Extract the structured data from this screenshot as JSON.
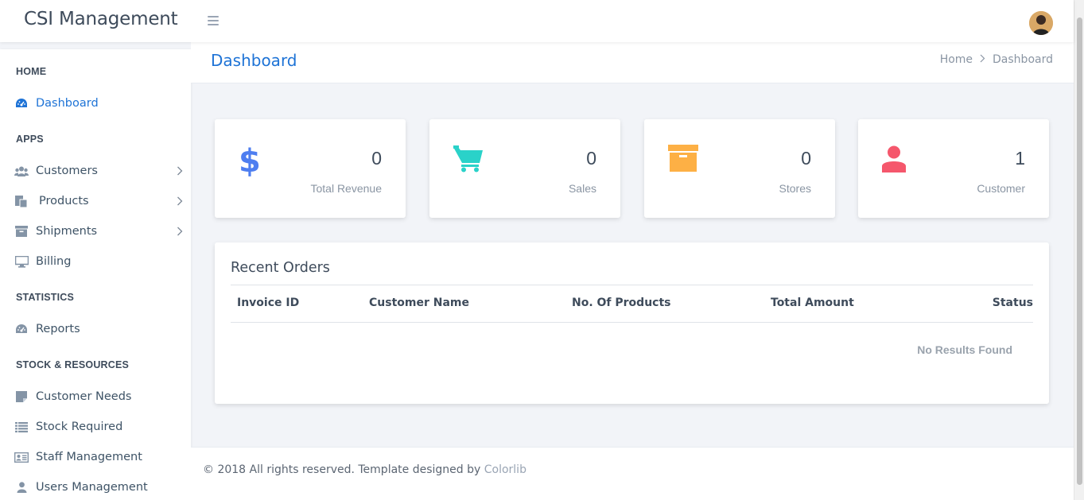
{
  "brand": "CSI Management",
  "header": {
    "menu_icon": "hamburger-icon",
    "avatar": "user-avatar"
  },
  "sidebar": {
    "sections": [
      "HOME",
      "APPS",
      "STATISTICS",
      "STOCK & RESOURCES"
    ],
    "items": [
      {
        "label": "Dashboard",
        "icon": "dashboard-icon",
        "active": true
      },
      {
        "label": "Customers",
        "icon": "users-icon",
        "has_children": true
      },
      {
        "label": "Products",
        "icon": "products-icon",
        "has_children": true
      },
      {
        "label": "Shipments",
        "icon": "archive-icon",
        "has_children": true
      },
      {
        "label": "Billing",
        "icon": "monitor-icon"
      },
      {
        "label": "Reports",
        "icon": "dashboard-icon"
      },
      {
        "label": "Customer Needs",
        "icon": "note-icon"
      },
      {
        "label": "Stock Required",
        "icon": "list-icon"
      },
      {
        "label": "Staff Management",
        "icon": "id-card-icon"
      },
      {
        "label": "Users Management",
        "icon": "user-icon"
      }
    ]
  },
  "page": {
    "title": "Dashboard",
    "breadcrumb": [
      "Home",
      "Dashboard"
    ]
  },
  "stats": [
    {
      "value": "0",
      "label": "Total Revenue",
      "icon": "dollar-icon",
      "color": "#4e7ef0"
    },
    {
      "value": "0",
      "label": "Sales",
      "icon": "cart-icon",
      "color": "#2ad2c9"
    },
    {
      "value": "0",
      "label": "Stores",
      "icon": "box-icon",
      "color": "#fdb045"
    },
    {
      "value": "1",
      "label": "Customer",
      "icon": "user-icon",
      "color": "#f5576c"
    }
  ],
  "recent_orders": {
    "title": "Recent Orders",
    "columns": [
      "Invoice ID",
      "Customer Name",
      "No. Of Products",
      "Total Amount",
      "Status"
    ],
    "rows": [],
    "empty_text": "No Results Found"
  },
  "footer": {
    "text": "© 2018 All rights reserved. Template designed by ",
    "link": "Colorlib"
  },
  "colors": {
    "accent": "#1e73d6"
  }
}
